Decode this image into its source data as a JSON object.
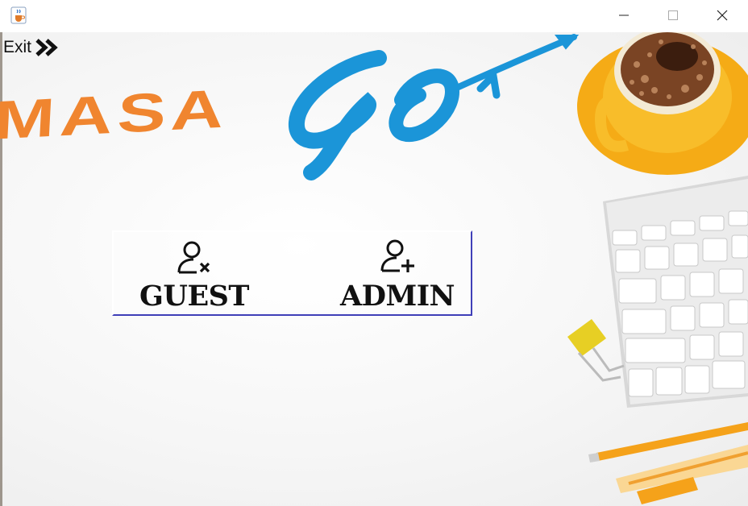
{
  "window": {
    "app_icon": "java-coffee-icon",
    "controls": {
      "minimize_icon": "minimize-icon",
      "maximize_icon": "maximize-icon",
      "close_icon": "close-icon"
    }
  },
  "nav": {
    "exit_label": "Exit",
    "exit_icon": "double-chevron-right-icon"
  },
  "logo": {
    "part1": "MASA",
    "part2": "GO",
    "part1_color": "#f0852f",
    "part2_color": "#1b95d8"
  },
  "options": [
    {
      "label": "GUEST",
      "icon": "user-remove-icon"
    },
    {
      "label": "ADMIN",
      "icon": "user-add-icon"
    }
  ],
  "colors": {
    "panel_border": "#3f3fb8",
    "mug": "#f7b21a",
    "coffee": "#6b3a1c",
    "keyboard": "#d8d8d8",
    "clip": "#e7cf24"
  }
}
